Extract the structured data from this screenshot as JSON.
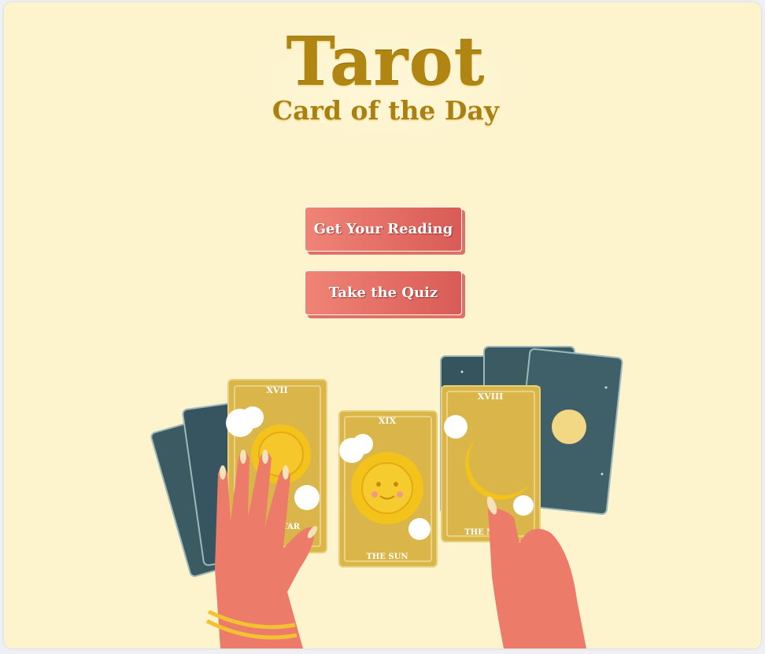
{
  "header": {
    "title": "Tarot",
    "subtitle": "Card of the Day"
  },
  "actions": {
    "reading_label": "Get Your Reading",
    "quiz_label": "Take the Quiz"
  },
  "illustration": {
    "card_left": {
      "numeral": "XVII",
      "name": "THE STAR"
    },
    "card_center": {
      "numeral": "XIX",
      "name": "THE SUN"
    },
    "card_right": {
      "numeral": "XVIII",
      "name": "THE MOON"
    },
    "colors": {
      "gold_card": "#d9b54a",
      "dark_card": "#3b5a62",
      "sun": "#f3c21b",
      "hand": "#ec7b6a",
      "bracelet": "#f2c232"
    }
  }
}
